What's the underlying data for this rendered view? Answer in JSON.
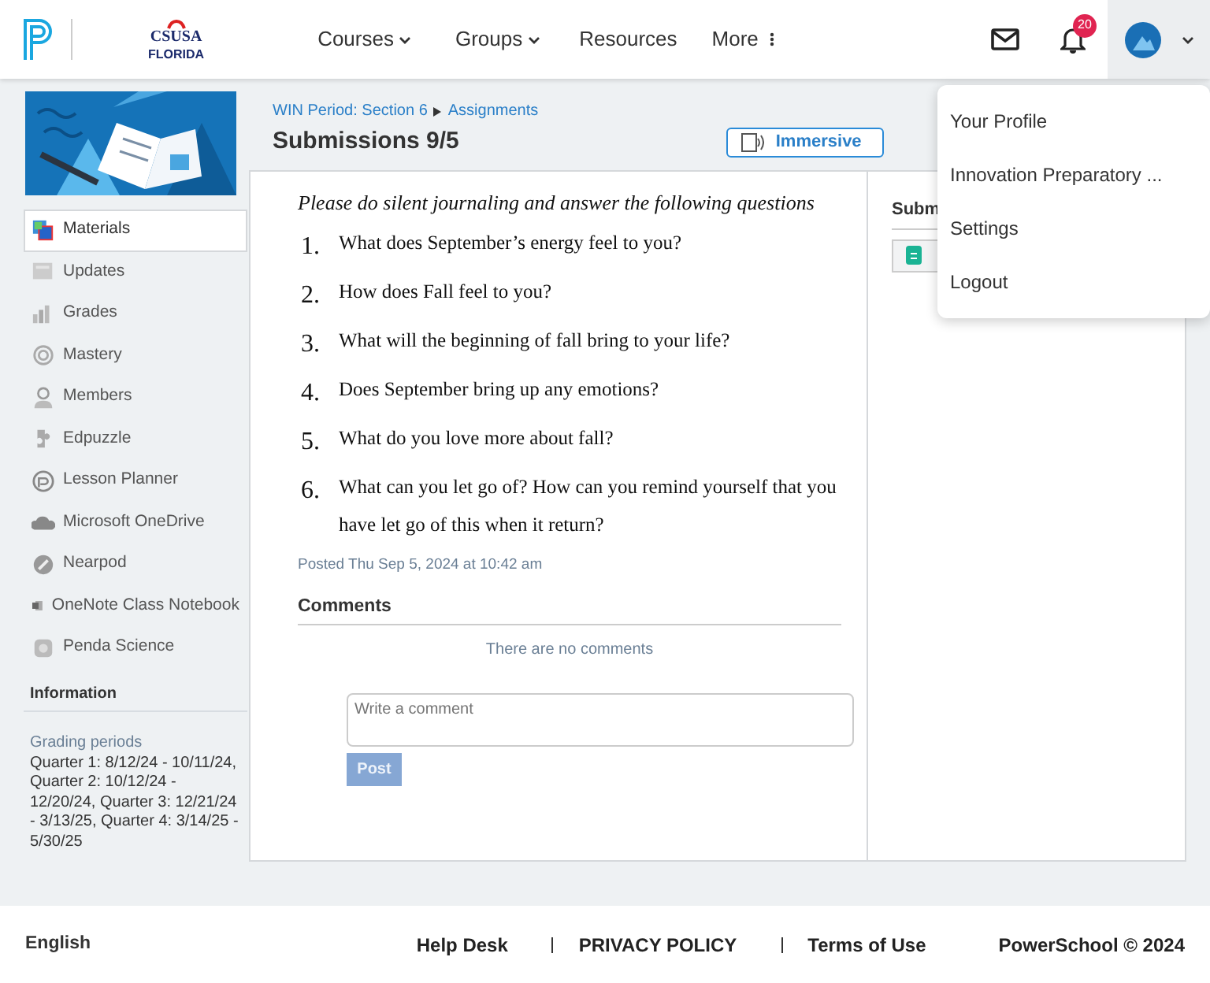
{
  "header": {
    "logo_top": "CSUSA",
    "logo_bottom": "FLORIDA",
    "nav": [
      {
        "label": "Courses",
        "kind": "dropdown"
      },
      {
        "label": "Groups",
        "kind": "dropdown"
      },
      {
        "label": "Resources",
        "kind": "link"
      },
      {
        "label": "More",
        "kind": "more"
      }
    ],
    "notification_count": "20"
  },
  "sidebar": {
    "items": [
      {
        "label": "Materials",
        "selected": true
      },
      {
        "label": "Updates",
        "selected": false
      },
      {
        "label": "Grades",
        "selected": false
      },
      {
        "label": "Mastery",
        "selected": false
      },
      {
        "label": "Members",
        "selected": false
      },
      {
        "label": "Edpuzzle",
        "selected": false
      },
      {
        "label": "Lesson Planner",
        "selected": false
      },
      {
        "label": "Microsoft OneDrive",
        "selected": false
      },
      {
        "label": "Nearpod",
        "selected": false
      },
      {
        "label": "OneNote Class Notebook",
        "selected": false
      },
      {
        "label": "Penda Science",
        "selected": false
      }
    ],
    "info_title": "Information",
    "info_label": "Grading periods",
    "info_text": "Quarter 1: 8/12/24 - 10/11/24, Quarter 2: 10/12/24 - 12/20/24, Quarter 3: 12/21/24 - 3/13/25, Quarter 4: 3/14/25 - 5/30/25"
  },
  "breadcrumb": [
    {
      "label": "WIN Period: Section 6"
    },
    {
      "label": "Assignments"
    }
  ],
  "title": "Submissions 9/5",
  "reader_button": "Immersive",
  "intro": "Please do silent journaling and answer the following questions",
  "questions": [
    {
      "number": "1.",
      "text": "What does September’s energy feel to you?"
    },
    {
      "number": "2.",
      "text": "How does Fall feel to you?"
    },
    {
      "number": "3.",
      "text": "What will the beginning of fall bring to your life?"
    },
    {
      "number": "4.",
      "text": "Does September bring up any emotions?"
    },
    {
      "number": "5.",
      "text": "What do you love more about fall?"
    },
    {
      "number": "6.",
      "text": "What can you let go of? How can you remind yourself that you have let go of this when it return?"
    }
  ],
  "posted": "Posted Thu Sep 5, 2024 at 10:42 am",
  "comments": {
    "title": "Comments",
    "empty": "There are no comments",
    "placeholder": "Write a comment",
    "button": "Post"
  },
  "side_panel": {
    "title": "Subm"
  },
  "menu": [
    {
      "label": "Your Profile"
    },
    {
      "label": "Innovation Preparatory ..."
    },
    {
      "label": "Settings"
    },
    {
      "label": "Logout"
    }
  ],
  "footer": {
    "language": "English",
    "links": [
      {
        "label": "Help Desk"
      },
      {
        "label": "PRIVACY POLICY"
      },
      {
        "label": "Terms of Use"
      }
    ],
    "copyright": "PowerSchool © 2024"
  }
}
